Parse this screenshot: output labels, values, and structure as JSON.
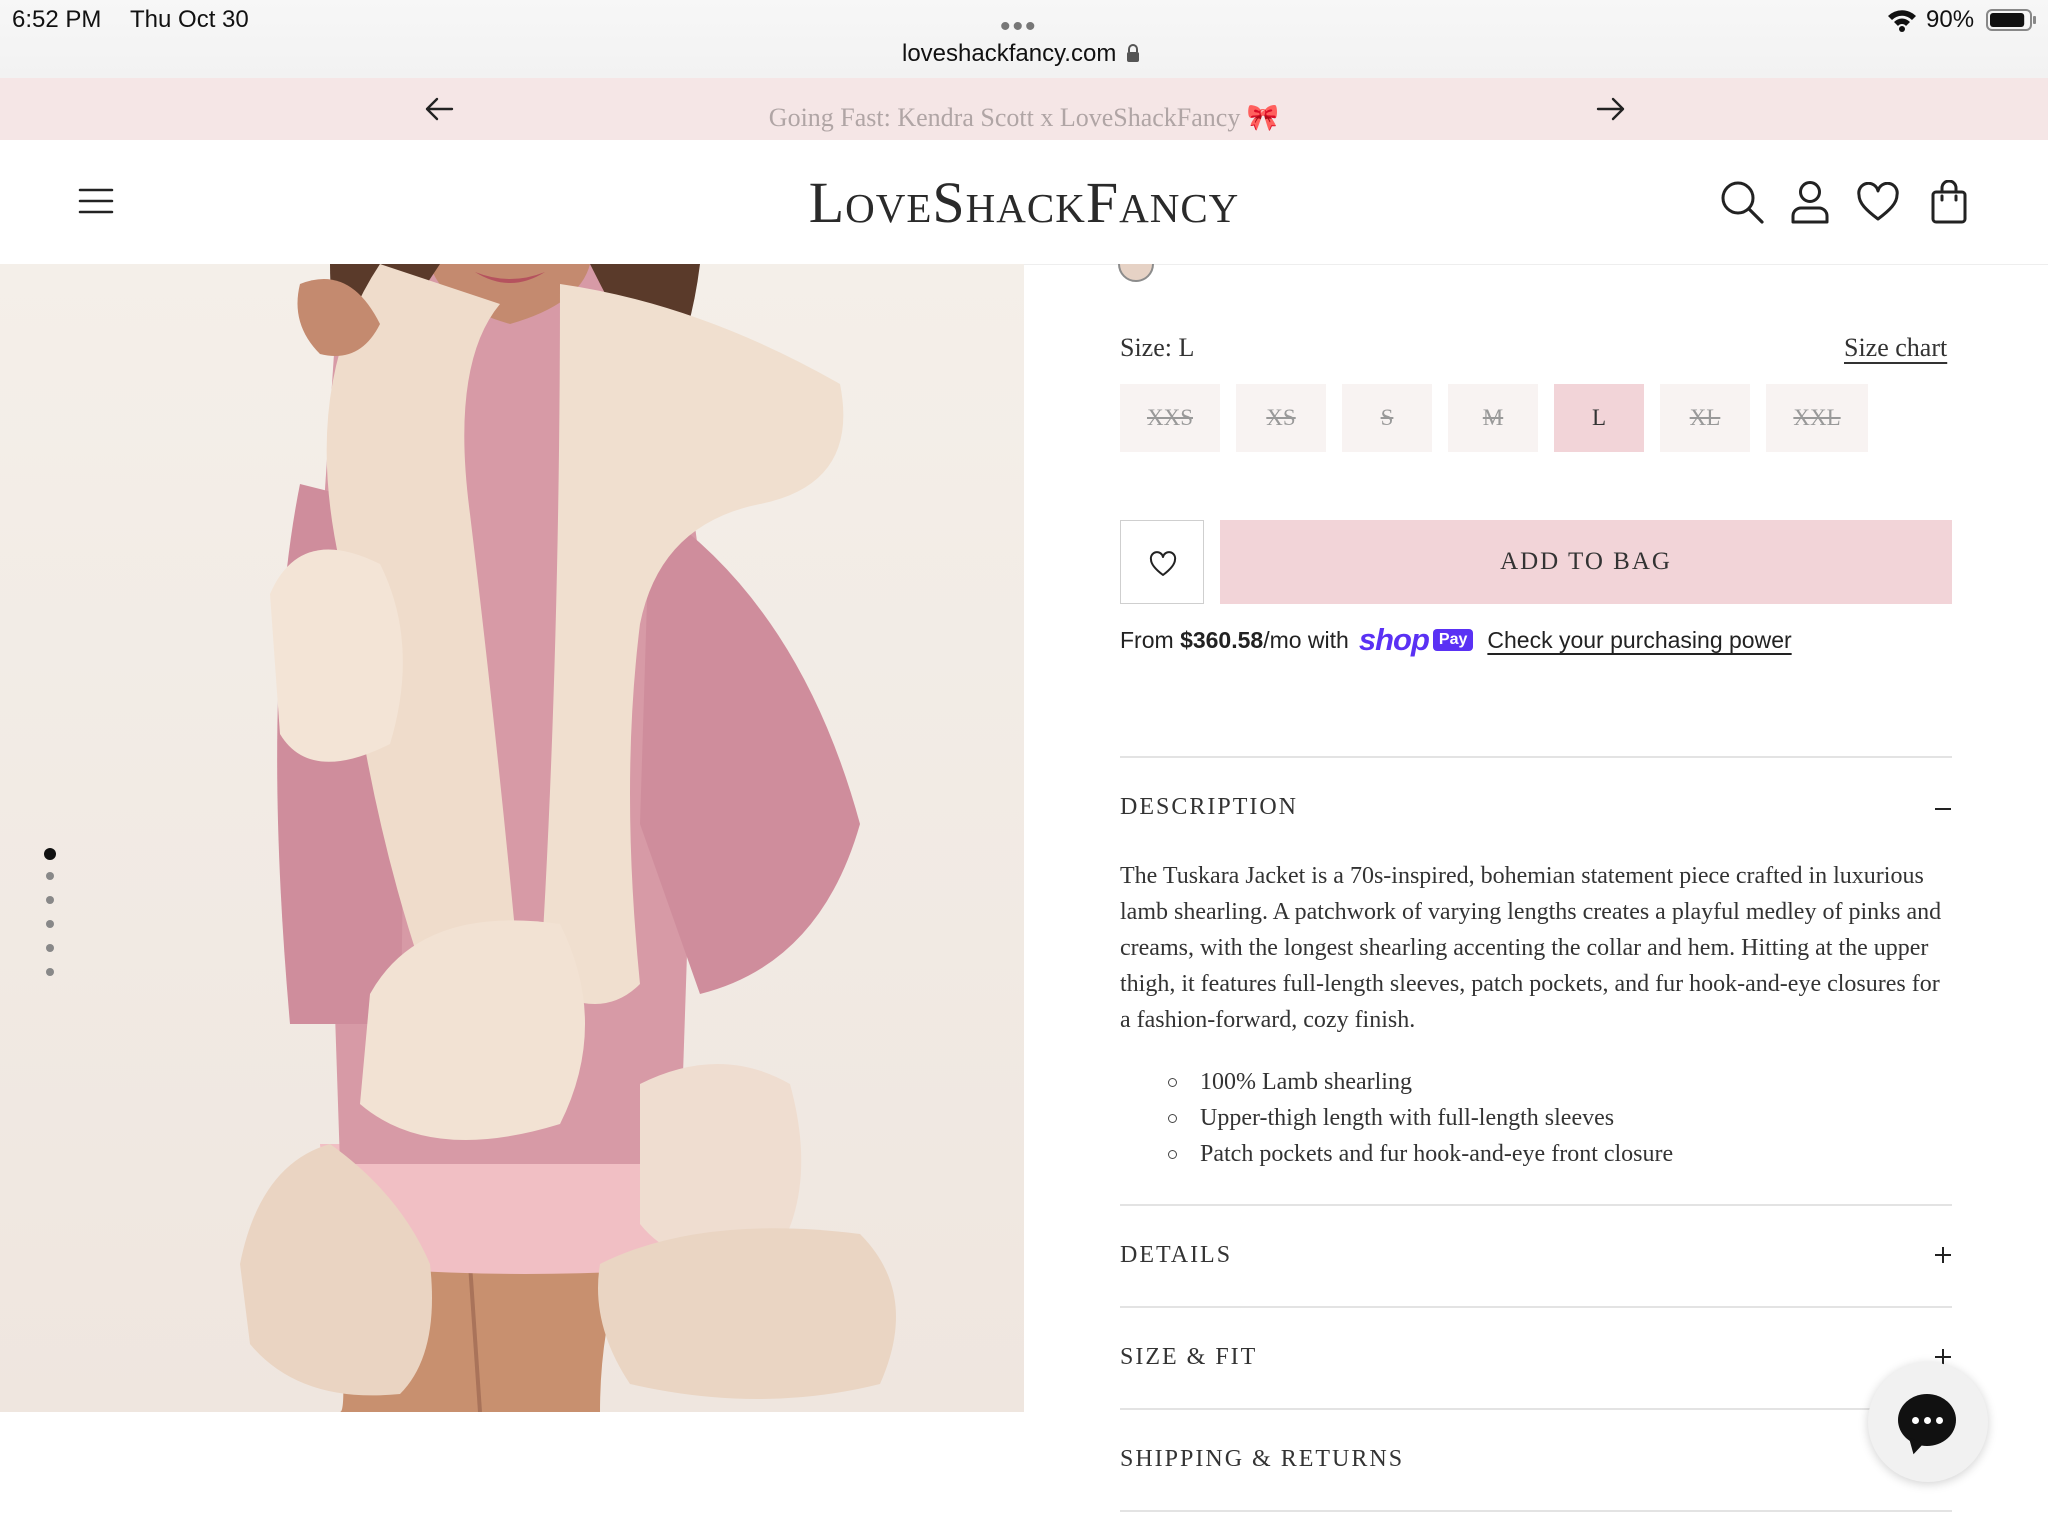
{
  "status_bar": {
    "time": "6:52 PM",
    "date": "Thu Oct 30",
    "multitask_dots": "•••",
    "url": "loveshackfancy.com",
    "battery_percent": "90%",
    "battery_level": 0.9
  },
  "promo": {
    "text": "Going Fast: Kendra Scott x LoveShackFancy",
    "emoji": "🎀"
  },
  "header": {
    "logo": "LoveShackFancy"
  },
  "gallery": {
    "image_count": 6,
    "active_index": 0
  },
  "product": {
    "size_label": "Size: L",
    "size_chart_link": "Size chart",
    "sizes": [
      {
        "label": "XXS",
        "available": false
      },
      {
        "label": "XS",
        "available": false
      },
      {
        "label": "S",
        "available": false
      },
      {
        "label": "M",
        "available": false
      },
      {
        "label": "L",
        "available": true,
        "selected": true
      },
      {
        "label": "XL",
        "available": false
      },
      {
        "label": "XXL",
        "available": false
      }
    ],
    "add_to_bag": "ADD TO BAG",
    "shop_pay": {
      "prefix": "From ",
      "amount": "$360.58",
      "suffix": "/mo with",
      "brand": "shop",
      "badge": "Pay",
      "link": "Check your purchasing power"
    }
  },
  "accordion": {
    "description": {
      "title": "DESCRIPTION",
      "expanded": true,
      "text": "The Tuskara Jacket is a 70s-inspired, bohemian statement piece crafted in luxurious lamb shearling. A patchwork of varying lengths creates a playful medley of pinks and creams, with the longest shearling accenting the collar and hem. Hitting at the upper thigh, it features full-length sleeves, patch pockets, and fur hook-and-eye closures for a fashion-forward, cozy finish.",
      "bullets": [
        "100% Lamb shearling",
        "Upper-thigh length with full-length sleeves",
        "Patch pockets and fur hook-and-eye front closure"
      ]
    },
    "details": {
      "title": "DETAILS",
      "expanded": false
    },
    "size_fit": {
      "title": "SIZE & FIT",
      "expanded": false
    },
    "shipping": {
      "title": "SHIPPING & RETURNS",
      "expanded": false
    }
  },
  "colors": {
    "promo_bg": "#f5e6e6",
    "button_pink": "#f2d4d8",
    "shop_pay_purple": "#5a31f4"
  }
}
